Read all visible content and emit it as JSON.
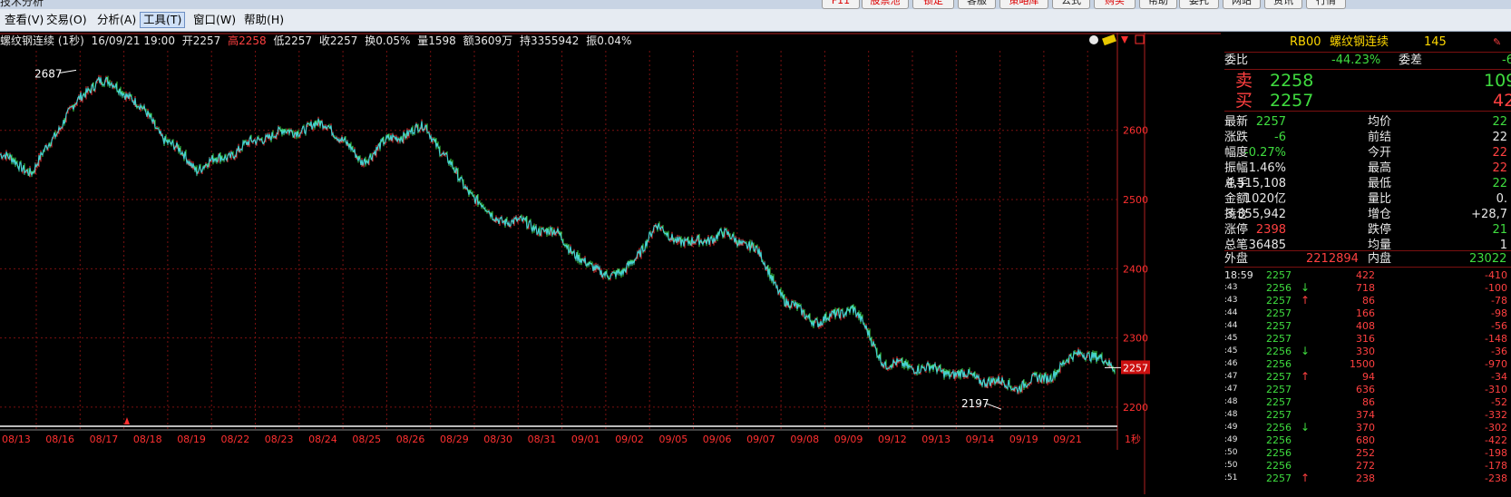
{
  "window": {
    "title": "技术分析"
  },
  "toolbar_buttons": [
    "F11",
    "股票池",
    "锁定",
    "客服",
    "策略库",
    "公式",
    "购买",
    "帮助",
    "委托",
    "网站",
    "资讯",
    "行情"
  ],
  "menu": [
    {
      "label": "查看(V)"
    },
    {
      "label": "交易(O)"
    },
    {
      "label": "分析(A)"
    },
    {
      "label": "工具(T)",
      "active": true
    },
    {
      "label": "窗口(W)"
    },
    {
      "label": "帮助(H)"
    }
  ],
  "infobar": {
    "name": "螺纹钢连续 (1秒)",
    "datetime": "16/09/21 19:00",
    "open": "开2257",
    "high": "高2258",
    "low": "低2257",
    "close": "收2257",
    "turnover": "换0.05%",
    "volume": "量1598",
    "amount": "额3609万",
    "oi": "持3355942",
    "amp": "振0.04%"
  },
  "chart_data": {
    "type": "line",
    "title": "",
    "x": [
      "08/13",
      "08/16",
      "08/17",
      "08/18",
      "08/19",
      "08/22",
      "08/23",
      "08/24",
      "08/25",
      "08/26",
      "08/29",
      "08/30",
      "08/31",
      "09/01",
      "09/02",
      "09/05",
      "09/06",
      "09/07",
      "09/08",
      "09/09",
      "09/12",
      "09/13",
      "09/14",
      "09/19",
      "09/21"
    ],
    "xlabel": "",
    "ylabel": "",
    "ylim": [
      2175,
      2715
    ],
    "yticks": [
      2200,
      2300,
      2400,
      2500,
      2600
    ],
    "grid": true,
    "last_price": "2257",
    "annotations": [
      {
        "label": "2687",
        "x": "08/16",
        "y": 2687
      },
      {
        "label": "2197",
        "x": "09/14",
        "y": 2197
      }
    ],
    "series": [
      {
        "values": [
          2565,
          2540,
          2620,
          2675,
          2650,
          2590,
          2545,
          2565,
          2590,
          2600,
          2610,
          2555,
          2590,
          2605,
          2530,
          2475,
          2465,
          2450,
          2400,
          2390,
          2460,
          2435,
          2450,
          2432,
          2350,
          2322,
          2345,
          2262,
          2258,
          2250,
          2240,
          2230,
          2245,
          2282,
          2257
        ]
      }
    ]
  },
  "panel": {
    "header": {
      "code": "RB00",
      "name": "螺纹钢连续",
      "count": "145"
    },
    "webi": {
      "label": "委比",
      "value": "-44.23%",
      "label2": "委差",
      "value2": "-6"
    },
    "sell": {
      "label": "卖",
      "price": "2258",
      "vol": "109"
    },
    "buy": {
      "label": "买",
      "price": "2257",
      "vol": "42"
    },
    "stats": [
      {
        "l": "最新",
        "v": "2257",
        "vc": "g",
        "l2": "均价",
        "v2": "22",
        "v2c": "g"
      },
      {
        "l": "涨跌",
        "v": "-6",
        "vc": "g",
        "l2": "前结",
        "v2": "22",
        "v2c": "w"
      },
      {
        "l": "幅度",
        "v": "-0.27%",
        "vc": "g",
        "l2": "今开",
        "v2": "22",
        "v2c": "r"
      },
      {
        "l": "振幅",
        "v": "1.46%",
        "vc": "w",
        "l2": "最高",
        "v2": "22",
        "v2c": "r"
      },
      {
        "l": "总手",
        "v": "4,515,108",
        "vc": "w",
        "l2": "最低",
        "v2": "22",
        "v2c": "g"
      },
      {
        "l": "金额",
        "v": "1020亿",
        "vc": "w",
        "l2": "量比",
        "v2": "0.",
        "v2c": "w"
      },
      {
        "l": "持仓",
        "v": "3,355,942",
        "vc": "w",
        "l2": "增仓",
        "v2": "+28,7",
        "v2c": "w"
      },
      {
        "l": "涨停",
        "v": "2398",
        "vc": "r",
        "l2": "跌停",
        "v2": "21",
        "v2c": "g"
      },
      {
        "l": "总笔",
        "v": "36485",
        "vc": "w",
        "l2": "均量",
        "v2": "1",
        "v2c": "w"
      }
    ],
    "outer": {
      "label": "外盘",
      "value": "2212894",
      "label2": "内盘",
      "value2": "23022"
    },
    "ticks": [
      {
        "t": "18:59",
        "p": "2257",
        "a": "",
        "v": "422",
        "c": "-410"
      },
      {
        "t": ":43",
        "p": "2256",
        "a": "↓",
        "v": "718",
        "c": "-100"
      },
      {
        "t": ":43",
        "p": "2257",
        "a": "↑",
        "v": "86",
        "c": "-78"
      },
      {
        "t": ":44",
        "p": "2257",
        "a": "",
        "v": "166",
        "c": "-98"
      },
      {
        "t": ":44",
        "p": "2257",
        "a": "",
        "v": "408",
        "c": "-56"
      },
      {
        "t": ":45",
        "p": "2257",
        "a": "",
        "v": "316",
        "c": "-148"
      },
      {
        "t": ":45",
        "p": "2256",
        "a": "↓",
        "v": "330",
        "c": "-36"
      },
      {
        "t": ":46",
        "p": "2256",
        "a": "",
        "v": "1500",
        "c": "-970"
      },
      {
        "t": ":47",
        "p": "2257",
        "a": "↑",
        "v": "94",
        "c": "-34"
      },
      {
        "t": ":47",
        "p": "2257",
        "a": "",
        "v": "636",
        "c": "-310"
      },
      {
        "t": ":48",
        "p": "2257",
        "a": "",
        "v": "86",
        "c": "-52"
      },
      {
        "t": ":48",
        "p": "2257",
        "a": "",
        "v": "374",
        "c": "-332"
      },
      {
        "t": ":49",
        "p": "2256",
        "a": "↓",
        "v": "370",
        "c": "-302"
      },
      {
        "t": ":49",
        "p": "2256",
        "a": "",
        "v": "680",
        "c": "-422"
      },
      {
        "t": ":50",
        "p": "2256",
        "a": "",
        "v": "252",
        "c": "-198"
      },
      {
        "t": ":50",
        "p": "2256",
        "a": "",
        "v": "272",
        "c": "-178"
      },
      {
        "t": ":51",
        "p": "2257",
        "a": "↑",
        "v": "238",
        "c": "-238"
      }
    ]
  },
  "period_label": "1秒",
  "colors": {
    "grid": "#7a1010",
    "axis": "#b02020",
    "price_line": "#46d0d0",
    "up": "#ff3030",
    "down": "#3fdc3f",
    "label": "#ff3030"
  }
}
